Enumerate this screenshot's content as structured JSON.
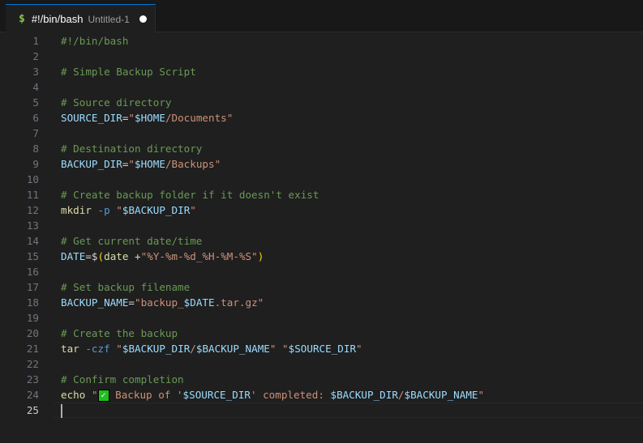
{
  "tab": {
    "icon": "$",
    "title": "#!/bin/bash",
    "description": "Untitled-1",
    "dirty_indicator": "unsaved-dot"
  },
  "colors": {
    "comment": "#6a9955",
    "variable": "#9cdcfe",
    "string": "#ce9178",
    "command": "#dcdcaa",
    "option": "#569cd6",
    "accent": "#0078d4"
  },
  "current_line": 25,
  "lines": [
    {
      "n": "1",
      "tokens": [
        {
          "t": "#!/bin/bash",
          "c": "comment"
        }
      ]
    },
    {
      "n": "2",
      "tokens": []
    },
    {
      "n": "3",
      "tokens": [
        {
          "t": "# Simple Backup Script",
          "c": "comment"
        }
      ]
    },
    {
      "n": "4",
      "tokens": []
    },
    {
      "n": "5",
      "tokens": [
        {
          "t": "# Source directory",
          "c": "comment"
        }
      ]
    },
    {
      "n": "6",
      "tokens": [
        {
          "t": "SOURCE_DIR",
          "c": "var"
        },
        {
          "t": "=",
          "c": "op"
        },
        {
          "t": "\"",
          "c": "str"
        },
        {
          "t": "$HOME",
          "c": "var"
        },
        {
          "t": "/Documents\"",
          "c": "str"
        }
      ]
    },
    {
      "n": "7",
      "tokens": []
    },
    {
      "n": "8",
      "tokens": [
        {
          "t": "# Destination directory",
          "c": "comment"
        }
      ]
    },
    {
      "n": "9",
      "tokens": [
        {
          "t": "BACKUP_DIR",
          "c": "var"
        },
        {
          "t": "=",
          "c": "op"
        },
        {
          "t": "\"",
          "c": "str"
        },
        {
          "t": "$HOME",
          "c": "var"
        },
        {
          "t": "/Backups\"",
          "c": "str"
        }
      ]
    },
    {
      "n": "10",
      "tokens": []
    },
    {
      "n": "11",
      "tokens": [
        {
          "t": "# Create backup folder if it doesn't exist",
          "c": "comment"
        }
      ]
    },
    {
      "n": "12",
      "tokens": [
        {
          "t": "mkdir",
          "c": "cmd"
        },
        {
          "t": " ",
          "c": "op"
        },
        {
          "t": "-p",
          "c": "opt"
        },
        {
          "t": " ",
          "c": "op"
        },
        {
          "t": "\"",
          "c": "str"
        },
        {
          "t": "$BACKUP_DIR",
          "c": "var"
        },
        {
          "t": "\"",
          "c": "str"
        }
      ]
    },
    {
      "n": "13",
      "tokens": []
    },
    {
      "n": "14",
      "tokens": [
        {
          "t": "# Get current date/time",
          "c": "comment"
        }
      ]
    },
    {
      "n": "15",
      "tokens": [
        {
          "t": "DATE",
          "c": "var"
        },
        {
          "t": "=$",
          "c": "op"
        },
        {
          "t": "(",
          "c": "paren"
        },
        {
          "t": "date",
          "c": "cmd"
        },
        {
          "t": " +",
          "c": "op"
        },
        {
          "t": "\"%Y-%m-%d_%H-%M-%S\"",
          "c": "str"
        },
        {
          "t": ")",
          "c": "paren"
        }
      ]
    },
    {
      "n": "16",
      "tokens": []
    },
    {
      "n": "17",
      "tokens": [
        {
          "t": "# Set backup filename",
          "c": "comment"
        }
      ]
    },
    {
      "n": "18",
      "tokens": [
        {
          "t": "BACKUP_NAME",
          "c": "var"
        },
        {
          "t": "=",
          "c": "op"
        },
        {
          "t": "\"backup_",
          "c": "str"
        },
        {
          "t": "$DATE",
          "c": "var"
        },
        {
          "t": ".tar.gz\"",
          "c": "str"
        }
      ]
    },
    {
      "n": "19",
      "tokens": []
    },
    {
      "n": "20",
      "tokens": [
        {
          "t": "# Create the backup",
          "c": "comment"
        }
      ]
    },
    {
      "n": "21",
      "tokens": [
        {
          "t": "tar",
          "c": "cmd"
        },
        {
          "t": " ",
          "c": "op"
        },
        {
          "t": "-czf",
          "c": "opt"
        },
        {
          "t": " ",
          "c": "op"
        },
        {
          "t": "\"",
          "c": "str"
        },
        {
          "t": "$BACKUP_DIR",
          "c": "var"
        },
        {
          "t": "/",
          "c": "str"
        },
        {
          "t": "$BACKUP_NAME",
          "c": "var"
        },
        {
          "t": "\" \"",
          "c": "str"
        },
        {
          "t": "$SOURCE_DIR",
          "c": "var"
        },
        {
          "t": "\"",
          "c": "str"
        }
      ]
    },
    {
      "n": "22",
      "tokens": []
    },
    {
      "n": "23",
      "tokens": [
        {
          "t": "# Confirm completion",
          "c": "comment"
        }
      ]
    },
    {
      "n": "24",
      "tokens": [
        {
          "t": "echo",
          "c": "cmd"
        },
        {
          "t": " ",
          "c": "op"
        },
        {
          "t": "\"",
          "c": "str"
        },
        {
          "t": "✓",
          "c": "emoji"
        },
        {
          "t": " Backup of '",
          "c": "str"
        },
        {
          "t": "$SOURCE_DIR",
          "c": "var"
        },
        {
          "t": "' completed: ",
          "c": "str"
        },
        {
          "t": "$BACKUP_DIR",
          "c": "var"
        },
        {
          "t": "/",
          "c": "str"
        },
        {
          "t": "$BACKUP_NAME",
          "c": "var"
        },
        {
          "t": "\"",
          "c": "str"
        }
      ]
    },
    {
      "n": "25",
      "tokens": []
    }
  ]
}
